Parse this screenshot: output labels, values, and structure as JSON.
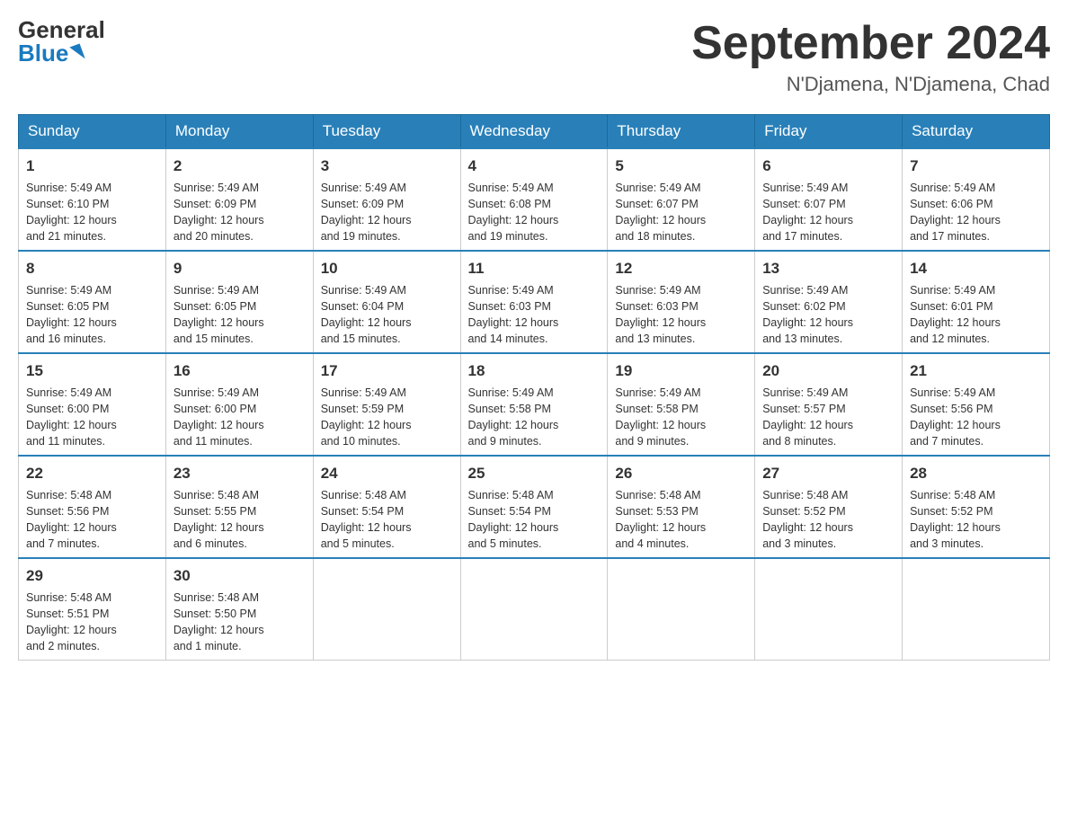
{
  "header": {
    "logo_general": "General",
    "logo_blue": "Blue",
    "month_title": "September 2024",
    "location": "N'Djamena, N'Djamena, Chad"
  },
  "days_of_week": [
    "Sunday",
    "Monday",
    "Tuesday",
    "Wednesday",
    "Thursday",
    "Friday",
    "Saturday"
  ],
  "weeks": [
    [
      {
        "day": "1",
        "sunrise": "5:49 AM",
        "sunset": "6:10 PM",
        "daylight": "12 hours and 21 minutes."
      },
      {
        "day": "2",
        "sunrise": "5:49 AM",
        "sunset": "6:09 PM",
        "daylight": "12 hours and 20 minutes."
      },
      {
        "day": "3",
        "sunrise": "5:49 AM",
        "sunset": "6:09 PM",
        "daylight": "12 hours and 19 minutes."
      },
      {
        "day": "4",
        "sunrise": "5:49 AM",
        "sunset": "6:08 PM",
        "daylight": "12 hours and 19 minutes."
      },
      {
        "day": "5",
        "sunrise": "5:49 AM",
        "sunset": "6:07 PM",
        "daylight": "12 hours and 18 minutes."
      },
      {
        "day": "6",
        "sunrise": "5:49 AM",
        "sunset": "6:07 PM",
        "daylight": "12 hours and 17 minutes."
      },
      {
        "day": "7",
        "sunrise": "5:49 AM",
        "sunset": "6:06 PM",
        "daylight": "12 hours and 17 minutes."
      }
    ],
    [
      {
        "day": "8",
        "sunrise": "5:49 AM",
        "sunset": "6:05 PM",
        "daylight": "12 hours and 16 minutes."
      },
      {
        "day": "9",
        "sunrise": "5:49 AM",
        "sunset": "6:05 PM",
        "daylight": "12 hours and 15 minutes."
      },
      {
        "day": "10",
        "sunrise": "5:49 AM",
        "sunset": "6:04 PM",
        "daylight": "12 hours and 15 minutes."
      },
      {
        "day": "11",
        "sunrise": "5:49 AM",
        "sunset": "6:03 PM",
        "daylight": "12 hours and 14 minutes."
      },
      {
        "day": "12",
        "sunrise": "5:49 AM",
        "sunset": "6:03 PM",
        "daylight": "12 hours and 13 minutes."
      },
      {
        "day": "13",
        "sunrise": "5:49 AM",
        "sunset": "6:02 PM",
        "daylight": "12 hours and 13 minutes."
      },
      {
        "day": "14",
        "sunrise": "5:49 AM",
        "sunset": "6:01 PM",
        "daylight": "12 hours and 12 minutes."
      }
    ],
    [
      {
        "day": "15",
        "sunrise": "5:49 AM",
        "sunset": "6:00 PM",
        "daylight": "12 hours and 11 minutes."
      },
      {
        "day": "16",
        "sunrise": "5:49 AM",
        "sunset": "6:00 PM",
        "daylight": "12 hours and 11 minutes."
      },
      {
        "day": "17",
        "sunrise": "5:49 AM",
        "sunset": "5:59 PM",
        "daylight": "12 hours and 10 minutes."
      },
      {
        "day": "18",
        "sunrise": "5:49 AM",
        "sunset": "5:58 PM",
        "daylight": "12 hours and 9 minutes."
      },
      {
        "day": "19",
        "sunrise": "5:49 AM",
        "sunset": "5:58 PM",
        "daylight": "12 hours and 9 minutes."
      },
      {
        "day": "20",
        "sunrise": "5:49 AM",
        "sunset": "5:57 PM",
        "daylight": "12 hours and 8 minutes."
      },
      {
        "day": "21",
        "sunrise": "5:49 AM",
        "sunset": "5:56 PM",
        "daylight": "12 hours and 7 minutes."
      }
    ],
    [
      {
        "day": "22",
        "sunrise": "5:48 AM",
        "sunset": "5:56 PM",
        "daylight": "12 hours and 7 minutes."
      },
      {
        "day": "23",
        "sunrise": "5:48 AM",
        "sunset": "5:55 PM",
        "daylight": "12 hours and 6 minutes."
      },
      {
        "day": "24",
        "sunrise": "5:48 AM",
        "sunset": "5:54 PM",
        "daylight": "12 hours and 5 minutes."
      },
      {
        "day": "25",
        "sunrise": "5:48 AM",
        "sunset": "5:54 PM",
        "daylight": "12 hours and 5 minutes."
      },
      {
        "day": "26",
        "sunrise": "5:48 AM",
        "sunset": "5:53 PM",
        "daylight": "12 hours and 4 minutes."
      },
      {
        "day": "27",
        "sunrise": "5:48 AM",
        "sunset": "5:52 PM",
        "daylight": "12 hours and 3 minutes."
      },
      {
        "day": "28",
        "sunrise": "5:48 AM",
        "sunset": "5:52 PM",
        "daylight": "12 hours and 3 minutes."
      }
    ],
    [
      {
        "day": "29",
        "sunrise": "5:48 AM",
        "sunset": "5:51 PM",
        "daylight": "12 hours and 2 minutes."
      },
      {
        "day": "30",
        "sunrise": "5:48 AM",
        "sunset": "5:50 PM",
        "daylight": "12 hours and 1 minute."
      },
      null,
      null,
      null,
      null,
      null
    ]
  ],
  "labels": {
    "sunrise": "Sunrise:",
    "sunset": "Sunset:",
    "daylight": "Daylight:"
  }
}
